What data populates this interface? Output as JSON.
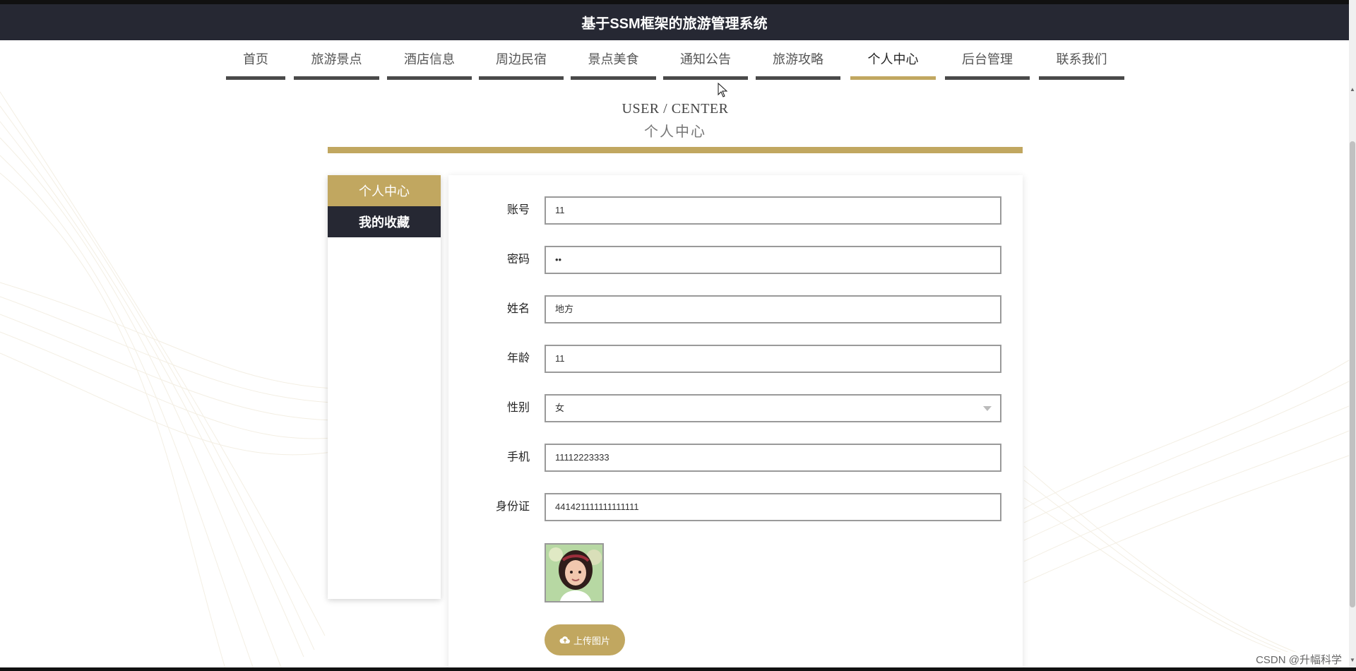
{
  "header": {
    "title": "基于SSM框架的旅游管理系统"
  },
  "nav": {
    "items": [
      {
        "label": "首页"
      },
      {
        "label": "旅游景点"
      },
      {
        "label": "酒店信息"
      },
      {
        "label": "周边民宿"
      },
      {
        "label": "景点美食"
      },
      {
        "label": "通知公告"
      },
      {
        "label": "旅游攻略"
      },
      {
        "label": "个人中心",
        "active": true
      },
      {
        "label": "后台管理"
      },
      {
        "label": "联系我们"
      }
    ]
  },
  "page": {
    "title_en": "USER / CENTER",
    "title_cn": "个人中心"
  },
  "sidebar": {
    "items": [
      {
        "label": "个人中心",
        "active": true
      },
      {
        "label": "我的收藏"
      }
    ]
  },
  "form": {
    "account": {
      "label": "账号",
      "value": "11"
    },
    "password": {
      "label": "密码",
      "value": "••"
    },
    "name": {
      "label": "姓名",
      "value": "地方"
    },
    "age": {
      "label": "年龄",
      "value": "11"
    },
    "gender": {
      "label": "性别",
      "value": "女"
    },
    "phone": {
      "label": "手机",
      "value": "11112223333"
    },
    "id_card": {
      "label": "身份证",
      "value": "441421111111111111"
    }
  },
  "upload": {
    "label": "上传图片",
    "icon": "cloud-upload-icon"
  },
  "watermark": "CSDN @升幅科学",
  "colors": {
    "accent": "#c1a760",
    "dark": "#262833",
    "nav_underline": "#4a4a4a"
  }
}
